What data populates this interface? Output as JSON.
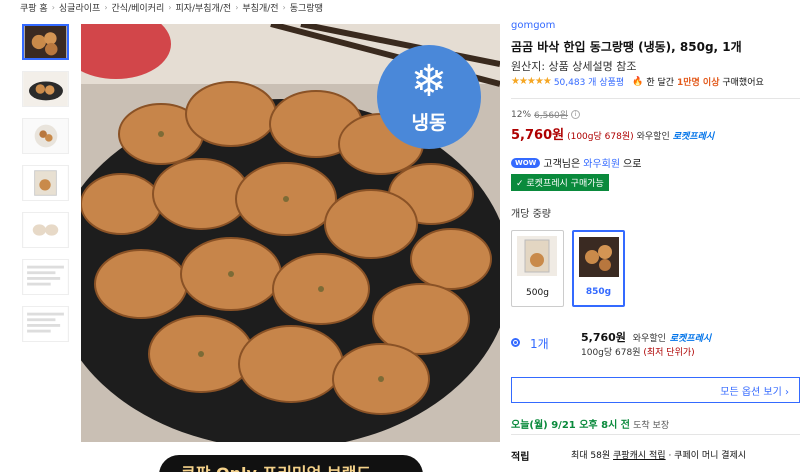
{
  "breadcrumb": [
    "쿠팡 홈",
    "싱글라이프",
    "간식/베이커리",
    "피자/부침개/전",
    "부침개/전",
    "동그랑땡"
  ],
  "main_image": {
    "badge_text": "냉동"
  },
  "promo_banner": {
    "text": "쿠팡 Only 프리미엄 브랜드"
  },
  "product": {
    "brand": "gomgom",
    "title": "곰곰 바삭 한입 동그랑땡 (냉동), 850g, 1개",
    "origin": "원산지: 상품 상세설명 참조",
    "stars": "★★★★★",
    "review_count": "50,483 개 상품평",
    "buy_prefix": "한 달간",
    "buy_highlight": "1만명 이상",
    "buy_suffix": "구매했어요"
  },
  "pricing": {
    "discount_rate": "12%",
    "original_price": "6,560원",
    "info_icon": "i",
    "price": "5,760원",
    "unit_price": "(100g당 678원)",
    "wow_discount": "와우할인",
    "rocket_badge": "로켓프레시"
  },
  "wow": {
    "pill": "WOW",
    "text_before": "고객님은",
    "link": "와우회원",
    "text_after": "으로",
    "fresh_tag": "✓ 로켓프레시 구매가능"
  },
  "options": {
    "label": "개당 중량",
    "items": [
      {
        "label": "500g",
        "selected": false
      },
      {
        "label": "850g",
        "selected": true
      }
    ]
  },
  "selection": {
    "qty": "1개",
    "price": "5,760원",
    "wow_discount": "와우할인",
    "rocket_badge": "로켓프레시",
    "unit": "100g당 678원",
    "lowest": "(최저 단위가)"
  },
  "all_options_button": "모든 옵션 보기 ›",
  "delivery": {
    "date": "오늘(월) 9/21 오후 8시 전",
    "guarantee": "도착 보장"
  },
  "points": {
    "key": "적립",
    "text_before": "최대 58원",
    "link": "쿠팡캐시 적립",
    "text_after": "· 쿠페이 머니 결제시"
  },
  "colors": {
    "accent": "#346aff",
    "price": "#ae0000",
    "rocket": "#0073e9",
    "fresh": "#0a8a3c",
    "badge": "#4a88d9"
  }
}
